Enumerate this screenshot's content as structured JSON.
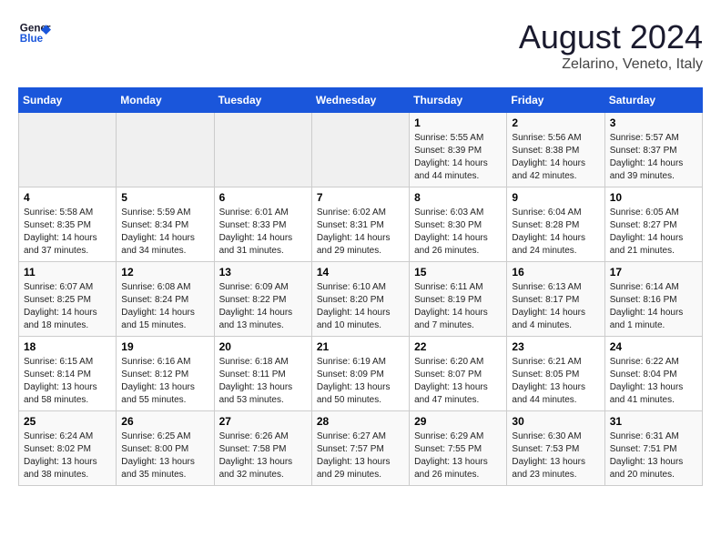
{
  "logo": {
    "line1": "General",
    "line2": "Blue"
  },
  "title": "August 2024",
  "subtitle": "Zelarino, Veneto, Italy",
  "days_of_week": [
    "Sunday",
    "Monday",
    "Tuesday",
    "Wednesday",
    "Thursday",
    "Friday",
    "Saturday"
  ],
  "weeks": [
    [
      {
        "day": "",
        "info": ""
      },
      {
        "day": "",
        "info": ""
      },
      {
        "day": "",
        "info": ""
      },
      {
        "day": "",
        "info": ""
      },
      {
        "day": "1",
        "info": "Sunrise: 5:55 AM\nSunset: 8:39 PM\nDaylight: 14 hours and 44 minutes."
      },
      {
        "day": "2",
        "info": "Sunrise: 5:56 AM\nSunset: 8:38 PM\nDaylight: 14 hours and 42 minutes."
      },
      {
        "day": "3",
        "info": "Sunrise: 5:57 AM\nSunset: 8:37 PM\nDaylight: 14 hours and 39 minutes."
      }
    ],
    [
      {
        "day": "4",
        "info": "Sunrise: 5:58 AM\nSunset: 8:35 PM\nDaylight: 14 hours and 37 minutes."
      },
      {
        "day": "5",
        "info": "Sunrise: 5:59 AM\nSunset: 8:34 PM\nDaylight: 14 hours and 34 minutes."
      },
      {
        "day": "6",
        "info": "Sunrise: 6:01 AM\nSunset: 8:33 PM\nDaylight: 14 hours and 31 minutes."
      },
      {
        "day": "7",
        "info": "Sunrise: 6:02 AM\nSunset: 8:31 PM\nDaylight: 14 hours and 29 minutes."
      },
      {
        "day": "8",
        "info": "Sunrise: 6:03 AM\nSunset: 8:30 PM\nDaylight: 14 hours and 26 minutes."
      },
      {
        "day": "9",
        "info": "Sunrise: 6:04 AM\nSunset: 8:28 PM\nDaylight: 14 hours and 24 minutes."
      },
      {
        "day": "10",
        "info": "Sunrise: 6:05 AM\nSunset: 8:27 PM\nDaylight: 14 hours and 21 minutes."
      }
    ],
    [
      {
        "day": "11",
        "info": "Sunrise: 6:07 AM\nSunset: 8:25 PM\nDaylight: 14 hours and 18 minutes."
      },
      {
        "day": "12",
        "info": "Sunrise: 6:08 AM\nSunset: 8:24 PM\nDaylight: 14 hours and 15 minutes."
      },
      {
        "day": "13",
        "info": "Sunrise: 6:09 AM\nSunset: 8:22 PM\nDaylight: 14 hours and 13 minutes."
      },
      {
        "day": "14",
        "info": "Sunrise: 6:10 AM\nSunset: 8:20 PM\nDaylight: 14 hours and 10 minutes."
      },
      {
        "day": "15",
        "info": "Sunrise: 6:11 AM\nSunset: 8:19 PM\nDaylight: 14 hours and 7 minutes."
      },
      {
        "day": "16",
        "info": "Sunrise: 6:13 AM\nSunset: 8:17 PM\nDaylight: 14 hours and 4 minutes."
      },
      {
        "day": "17",
        "info": "Sunrise: 6:14 AM\nSunset: 8:16 PM\nDaylight: 14 hours and 1 minute."
      }
    ],
    [
      {
        "day": "18",
        "info": "Sunrise: 6:15 AM\nSunset: 8:14 PM\nDaylight: 13 hours and 58 minutes."
      },
      {
        "day": "19",
        "info": "Sunrise: 6:16 AM\nSunset: 8:12 PM\nDaylight: 13 hours and 55 minutes."
      },
      {
        "day": "20",
        "info": "Sunrise: 6:18 AM\nSunset: 8:11 PM\nDaylight: 13 hours and 53 minutes."
      },
      {
        "day": "21",
        "info": "Sunrise: 6:19 AM\nSunset: 8:09 PM\nDaylight: 13 hours and 50 minutes."
      },
      {
        "day": "22",
        "info": "Sunrise: 6:20 AM\nSunset: 8:07 PM\nDaylight: 13 hours and 47 minutes."
      },
      {
        "day": "23",
        "info": "Sunrise: 6:21 AM\nSunset: 8:05 PM\nDaylight: 13 hours and 44 minutes."
      },
      {
        "day": "24",
        "info": "Sunrise: 6:22 AM\nSunset: 8:04 PM\nDaylight: 13 hours and 41 minutes."
      }
    ],
    [
      {
        "day": "25",
        "info": "Sunrise: 6:24 AM\nSunset: 8:02 PM\nDaylight: 13 hours and 38 minutes."
      },
      {
        "day": "26",
        "info": "Sunrise: 6:25 AM\nSunset: 8:00 PM\nDaylight: 13 hours and 35 minutes."
      },
      {
        "day": "27",
        "info": "Sunrise: 6:26 AM\nSunset: 7:58 PM\nDaylight: 13 hours and 32 minutes."
      },
      {
        "day": "28",
        "info": "Sunrise: 6:27 AM\nSunset: 7:57 PM\nDaylight: 13 hours and 29 minutes."
      },
      {
        "day": "29",
        "info": "Sunrise: 6:29 AM\nSunset: 7:55 PM\nDaylight: 13 hours and 26 minutes."
      },
      {
        "day": "30",
        "info": "Sunrise: 6:30 AM\nSunset: 7:53 PM\nDaylight: 13 hours and 23 minutes."
      },
      {
        "day": "31",
        "info": "Sunrise: 6:31 AM\nSunset: 7:51 PM\nDaylight: 13 hours and 20 minutes."
      }
    ]
  ]
}
